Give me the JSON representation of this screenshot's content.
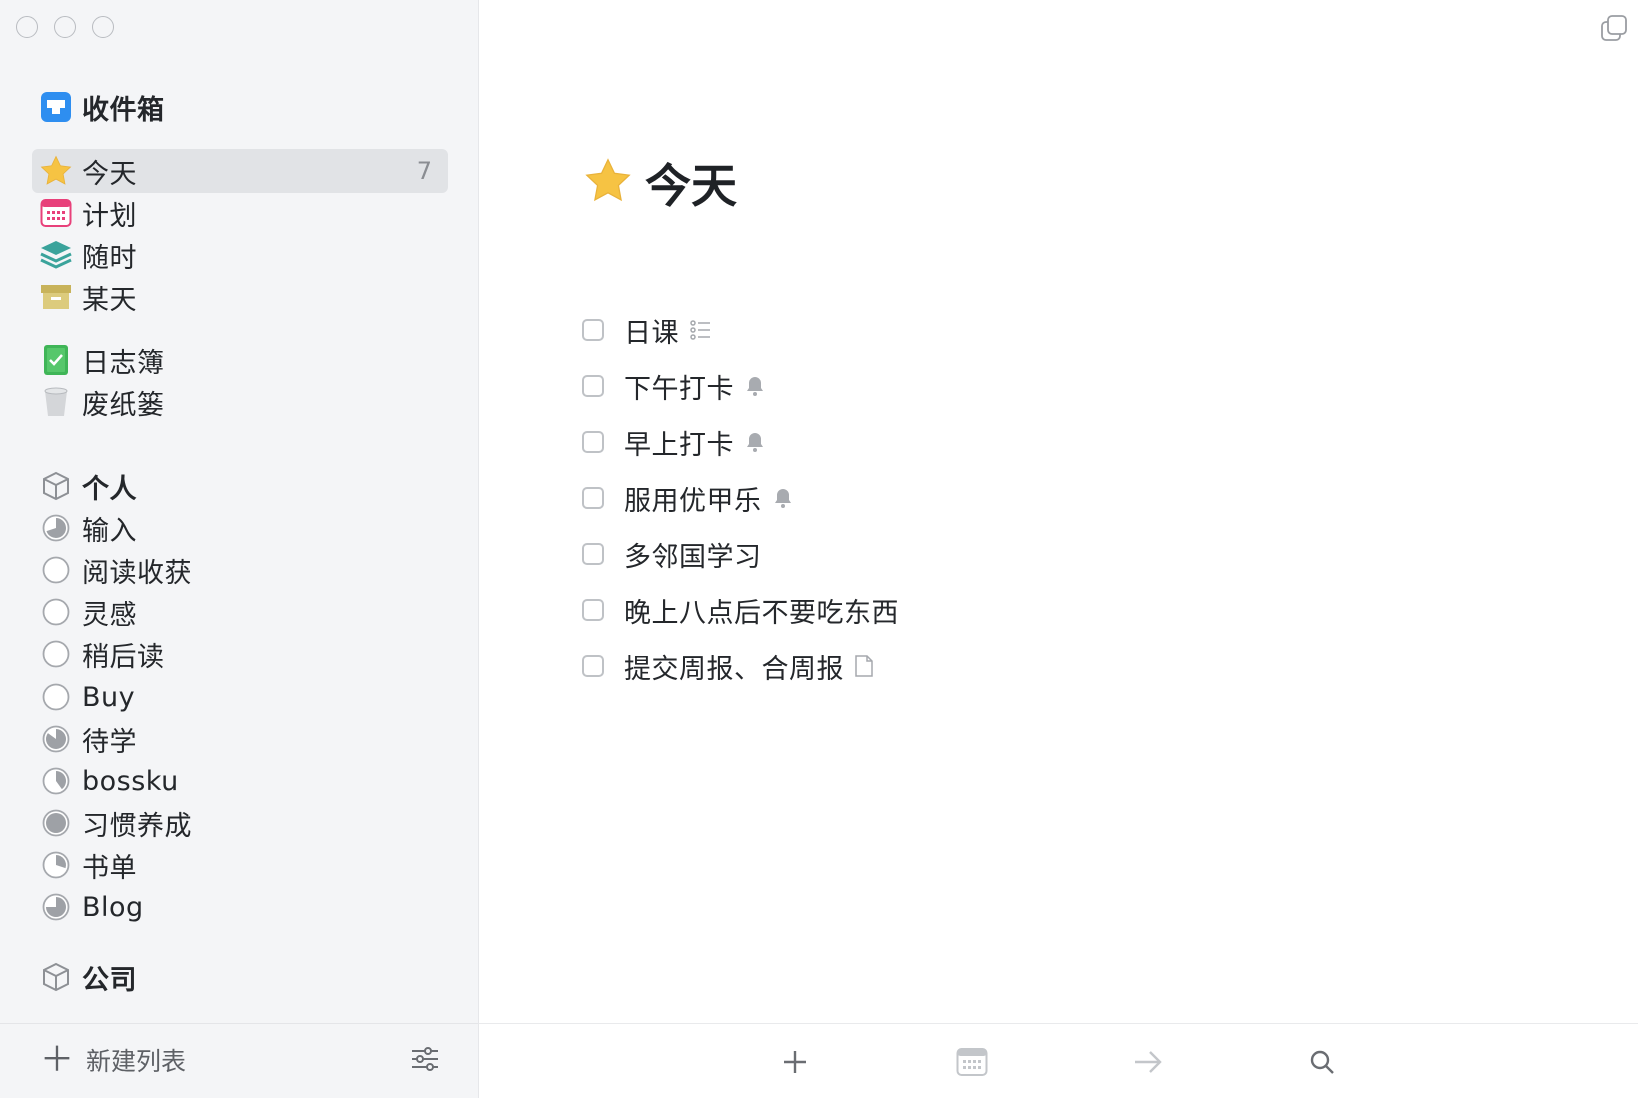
{
  "colors": {
    "accent": "#f6c343",
    "inbox": "#2e8ef0",
    "calendar": "#e8407a",
    "anytime": "#3aa39b",
    "someday": "#c8b35b",
    "logbook": "#3fb557"
  },
  "sidebar": {
    "inbox": {
      "label": "收件箱",
      "icon": "inbox-icon"
    },
    "items": [
      {
        "label": "今天",
        "icon": "star-icon",
        "count": "7"
      },
      {
        "label": "计划",
        "icon": "calendar-icon"
      },
      {
        "label": "随时",
        "icon": "layers-icon"
      },
      {
        "label": "某天",
        "icon": "box-icon"
      }
    ],
    "logbook": {
      "label": "日志簿",
      "icon": "logbook-icon"
    },
    "trash": {
      "label": "废纸篓",
      "icon": "trash-icon"
    },
    "area_personal": {
      "label": "个人",
      "icon": "cube-icon"
    },
    "projects": [
      {
        "label": "输入",
        "progress": 0.7
      },
      {
        "label": "阅读收获",
        "progress": 0
      },
      {
        "label": "灵感",
        "progress": 0
      },
      {
        "label": "稍后读",
        "progress": 0
      },
      {
        "label": "Buy",
        "progress": 0
      },
      {
        "label": "待学",
        "progress": 0.85
      },
      {
        "label": "bossku",
        "progress": 0.4
      },
      {
        "label": "习惯养成",
        "progress": 1.0
      },
      {
        "label": "书单",
        "progress": 0.3
      },
      {
        "label": "Blog",
        "progress": 0.75
      }
    ],
    "area_company": {
      "label": "公司",
      "icon": "cube-icon"
    },
    "footer": {
      "new_list": "新建列表",
      "settings_icon": "sliders-icon"
    }
  },
  "main": {
    "title": "今天",
    "title_icon": "star-icon",
    "tasks": [
      {
        "label": "日课",
        "icon": "checklist-icon"
      },
      {
        "label": "下午打卡",
        "icon": "bell-icon"
      },
      {
        "label": "早上打卡",
        "icon": "bell-icon"
      },
      {
        "label": "服用优甲乐",
        "icon": "bell-icon"
      },
      {
        "label": "多邻国学习",
        "icon": ""
      },
      {
        "label": "晚上八点后不要吃东西",
        "icon": ""
      },
      {
        "label": "提交周报、合周报",
        "icon": "note-icon"
      }
    ],
    "toolbar": [
      "add-task-icon",
      "calendar-icon",
      "move-arrow-icon",
      "search-icon"
    ]
  }
}
